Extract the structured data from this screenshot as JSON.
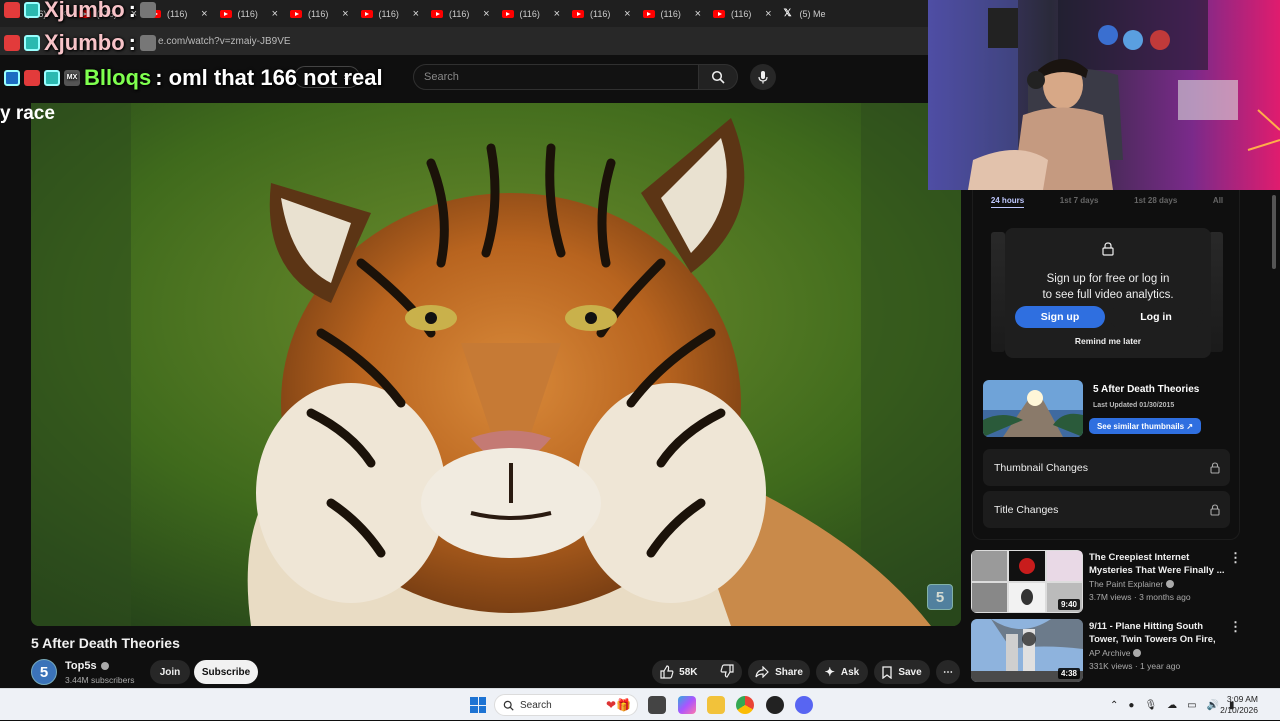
{
  "tabs": [
    {
      "label": "(116)",
      "icon": "youtube-icon"
    },
    {
      "label": "(116)",
      "icon": "youtube-icon"
    },
    {
      "label": "(116)",
      "icon": "youtube-icon"
    },
    {
      "label": "(116)",
      "icon": "youtube-icon"
    },
    {
      "label": "(116)",
      "icon": "youtube-icon"
    },
    {
      "label": "(116)",
      "icon": "youtube-icon"
    },
    {
      "label": "(116)",
      "icon": "youtube-icon"
    },
    {
      "label": "(116)",
      "icon": "youtube-icon"
    },
    {
      "label": "(116)",
      "icon": "youtube-icon"
    },
    {
      "label": "(116)",
      "icon": "youtube-icon"
    },
    {
      "label": "(116)",
      "icon": "youtube-icon"
    },
    {
      "label": "(5) Me",
      "icon": "x-icon"
    }
  ],
  "address_bar": {
    "url": "e.com/watch?v=zmaiy-JB9VE"
  },
  "header": {
    "search_placeholder": "Search"
  },
  "chat_overlay": {
    "line1_user": "Xjumbo",
    "line1_text": ":",
    "line2_user": "Xjumbo",
    "line2_text": ":",
    "line3_user": "Blloqs",
    "line3_text": ": oml that 166 not real",
    "badge_text": "MX"
  },
  "race_text": "y race",
  "video": {
    "title": "5 After Death Theories",
    "watermark": "5",
    "channel_avatar": "5",
    "channel_name": "Top5s",
    "subscribers": "3.44M subscribers",
    "join_label": "Join",
    "subscribe_label": "Subscribe",
    "likes": "58K",
    "share_label": "Share",
    "ask_label": "Ask",
    "save_label": "Save"
  },
  "analytics": {
    "tabs": [
      "24 hours",
      "1st 7 days",
      "1st 28 days",
      "All"
    ],
    "signup_line1": "Sign up for free or log in",
    "signup_line2": "to see full video analytics.",
    "signup_label": "Sign up",
    "login_label": "Log in",
    "remind_label": "Remind me later",
    "thumb_title": "5 After Death Theories",
    "last_updated": "Last Updated 01/30/2015",
    "similar_label": "See similar thumbnails ↗",
    "thumbnail_changes": "Thumbnail Changes",
    "title_changes": "Title Changes"
  },
  "recommendations": [
    {
      "title": "The Creepiest Internet Mysteries That Were Finally ...",
      "channel": "The Paint Explainer",
      "meta": "3.7M views · 3 months ago",
      "duration": "9:40"
    },
    {
      "title": "9/11 - Plane Hitting South Tower, Twin Towers On Fire, ...",
      "channel": "AP Archive",
      "meta": "331K views · 1 year ago",
      "duration": "4:38"
    }
  ],
  "taskbar": {
    "search_label": "Search",
    "time": "3:09 AM",
    "date": "2/10/2026"
  },
  "colors": {
    "accent_blue": "#2f6fe0",
    "youtube_red": "#ff0000",
    "chat_pink": "#f7c3c8",
    "chat_green": "#7fff4f"
  }
}
